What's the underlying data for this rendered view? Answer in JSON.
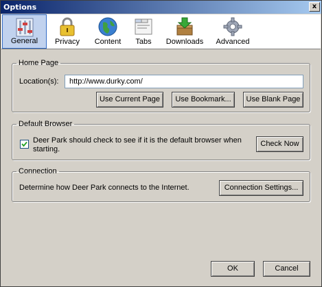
{
  "window": {
    "title": "Options",
    "close_glyph": "x"
  },
  "tabs": [
    {
      "label": "General",
      "icon": "general-settings-icon",
      "active": true
    },
    {
      "label": "Privacy",
      "icon": "padlock-icon",
      "active": false
    },
    {
      "label": "Content",
      "icon": "globe-icon",
      "active": false
    },
    {
      "label": "Tabs",
      "icon": "tabs-window-icon",
      "active": false
    },
    {
      "label": "Downloads",
      "icon": "downloads-box-icon",
      "active": false
    },
    {
      "label": "Advanced",
      "icon": "gear-icon",
      "active": false
    }
  ],
  "home_page": {
    "legend": "Home Page",
    "location_label": "Location(s):",
    "location_value": "http://www.durky.com/",
    "use_current_label": "Use Current Page",
    "use_bookmark_label": "Use Bookmark...",
    "use_blank_label": "Use Blank Page"
  },
  "default_browser": {
    "legend": "Default Browser",
    "check_label": "Deer Park should check to see if it is the default browser when starting.",
    "checked": true,
    "check_now_label": "Check Now"
  },
  "connection": {
    "legend": "Connection",
    "description": "Determine how Deer Park connects to the Internet.",
    "settings_label": "Connection Settings..."
  },
  "footer": {
    "ok_label": "OK",
    "cancel_label": "Cancel"
  }
}
